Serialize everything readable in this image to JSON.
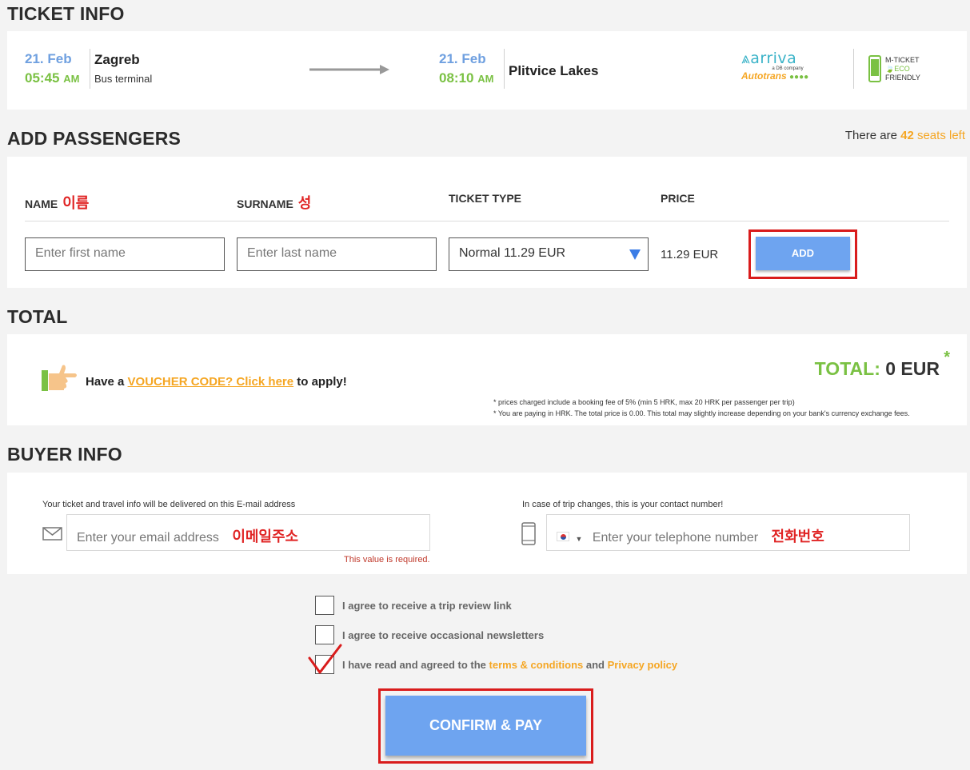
{
  "ticket_info": {
    "title": "TICKET INFO",
    "departure": {
      "date": "21. Feb",
      "time": "05:45",
      "ampm": "AM",
      "city": "Zagreb",
      "station": "Bus terminal"
    },
    "arrival": {
      "date": "21. Feb",
      "time": "08:10",
      "ampm": "AM",
      "city": "Plitvice Lakes"
    },
    "carrier_logo_top": "arriva",
    "carrier_logo_sub": "a DB company",
    "carrier_logo_bottom": "Autotrans",
    "eco": {
      "line1": "M-TICKET",
      "line2": "ECO",
      "line3": "FRIENDLY"
    }
  },
  "passengers": {
    "title": "ADD PASSENGERS",
    "seats_prefix": "There are",
    "seats_count": "42",
    "seats_suffix": "seats left",
    "headers": {
      "name": "NAME",
      "name_kr": "이름",
      "surname": "SURNAME",
      "surname_kr": "성",
      "ticket_type": "TICKET TYPE",
      "price": "PRICE"
    },
    "first_name_placeholder": "Enter first name",
    "last_name_placeholder": "Enter last name",
    "ticket_type_value": "Normal 11.29 EUR",
    "price_value": "11.29 EUR",
    "add_label": "ADD"
  },
  "total": {
    "title": "TOTAL",
    "voucher_prefix": "Have a",
    "voucher_link": "VOUCHER CODE? Click here",
    "voucher_suffix": "to apply!",
    "total_label": "TOTAL:",
    "total_value": "0 EUR",
    "total_star": "*",
    "fine1": "* prices charged include a booking fee of 5% (min 5 HRK, max 20 HRK per passenger per trip)",
    "fine2": "* You are paying in HRK. The total price is 0.00. This total may slightly increase depending on your bank's currency exchange fees."
  },
  "buyer": {
    "title": "BUYER INFO",
    "email_hint": "Your ticket and travel info will be delivered on this E-mail address",
    "email_placeholder": "Enter your email address",
    "email_kr": "이메일주소",
    "email_error": "This value is required.",
    "phone_hint": "In case of trip changes, this is your contact number!",
    "phone_placeholder": "Enter your telephone number",
    "phone_kr": "전화번호"
  },
  "agreements": {
    "review": "I agree to receive a trip review link",
    "newsletter": "I agree to receive occasional newsletters",
    "terms_prefix": "I have read and agreed to the",
    "terms_link": "terms & conditions",
    "terms_and": "and",
    "privacy_link": "Privacy policy"
  },
  "confirm_label": "CONFIRM & PAY",
  "colors": {
    "accent_blue": "#6ea4f0",
    "accent_green": "#7ac143",
    "accent_orange": "#f5a623",
    "highlight_red": "#d91c1c"
  }
}
